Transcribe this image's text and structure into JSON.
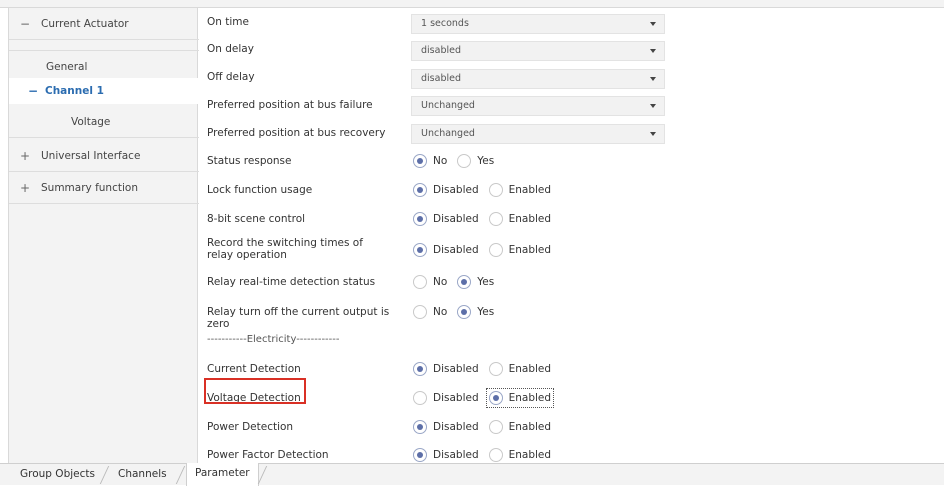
{
  "sidebar": {
    "items": [
      {
        "icon": "minus-icon",
        "label": "Current Actuator"
      },
      {
        "icon": "",
        "label": "General"
      },
      {
        "icon": "minus-icon",
        "label": "Channel 1"
      },
      {
        "icon": "",
        "label": "Voltage"
      },
      {
        "icon": "plus-icon",
        "label": "Universal Interface"
      },
      {
        "icon": "plus-icon",
        "label": "Summary function"
      }
    ],
    "active_item": "Channel 1"
  },
  "params": {
    "on_time": {
      "label": "On time",
      "value": "1 seconds"
    },
    "on_delay": {
      "label": "On delay",
      "value": "disabled"
    },
    "off_delay": {
      "label": "Off delay",
      "value": "disabled"
    },
    "bus_failure": {
      "label": "Preferred position at bus failure",
      "value": "Unchanged"
    },
    "bus_recovery": {
      "label": "Preferred position at bus recovery",
      "value": "Unchanged"
    },
    "status_response": {
      "label": "Status response",
      "options": [
        "No",
        "Yes"
      ],
      "selected": "No"
    },
    "lock_function": {
      "label": "Lock function usage",
      "options": [
        "Disabled",
        "Enabled"
      ],
      "selected": "Disabled"
    },
    "scene_control": {
      "label": "8-bit scene control",
      "options": [
        "Disabled",
        "Enabled"
      ],
      "selected": "Disabled"
    },
    "record_switching": {
      "label": "Record the switching times of relay operation",
      "options": [
        "Disabled",
        "Enabled"
      ],
      "selected": "Disabled"
    },
    "relay_detection": {
      "label": "Relay real-time detection status",
      "options": [
        "No",
        "Yes"
      ],
      "selected": "Yes"
    },
    "relay_zero": {
      "label": "Relay turn off the current output is zero",
      "options": [
        "No",
        "Yes"
      ],
      "selected": "Yes"
    },
    "section": {
      "label": "-----------Electricity------------"
    },
    "current_detection": {
      "label": "Current Detection",
      "options": [
        "Disabled",
        "Enabled"
      ],
      "selected": "Disabled"
    },
    "voltage_detection": {
      "label": "Voltage Detection",
      "options": [
        "Disabled",
        "Enabled"
      ],
      "selected": "Enabled"
    },
    "power_detection": {
      "label": "Power Detection",
      "options": [
        "Disabled",
        "Enabled"
      ],
      "selected": "Disabled"
    },
    "power_factor_detection": {
      "label": "Power Factor Detection",
      "options": [
        "Disabled",
        "Enabled"
      ],
      "selected": "Disabled"
    }
  },
  "tabs": [
    {
      "label": "Group Objects"
    },
    {
      "label": "Channels"
    },
    {
      "label": "Parameter"
    }
  ],
  "active_tab": "Parameter",
  "colors": {
    "highlight": "#d93025",
    "active_text": "#2b6cb0",
    "radio_selected": "#5d6fa8"
  }
}
